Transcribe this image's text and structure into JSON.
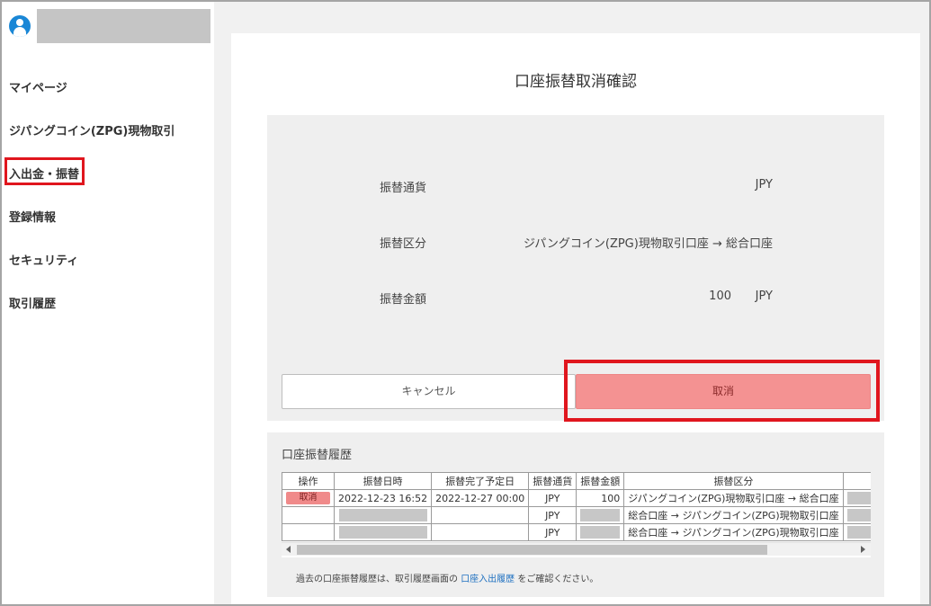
{
  "sidebar": {
    "items": [
      {
        "label": "マイページ"
      },
      {
        "label": "ジパングコイン(ZPG)現物取引"
      },
      {
        "label": "入出金・振替"
      },
      {
        "label": "登録情報"
      },
      {
        "label": "セキュリティ"
      },
      {
        "label": "取引履歴"
      }
    ]
  },
  "page": {
    "title": "口座振替取消確認"
  },
  "confirm": {
    "rows": [
      {
        "label": "振替通貨",
        "value": "JPY"
      },
      {
        "label": "振替区分",
        "value": "ジパングコイン(ZPG)現物取引口座 → 総合口座"
      },
      {
        "label": "振替金額",
        "amount": "100",
        "currency": "JPY"
      }
    ],
    "cancel_label": "キャンセル",
    "confirm_label": "取消"
  },
  "history": {
    "title": "口座振替履歴",
    "columns": [
      "操作",
      "振替日時",
      "振替完了予定日",
      "振替通貨",
      "振替金額",
      "振替区分"
    ],
    "rows": [
      {
        "action": "取消",
        "datetime": "2022-12-23 16:52",
        "due": "2022-12-27 00:00",
        "currency": "JPY",
        "amount": "100",
        "type": "ジパングコイン(ZPG)現物取引口座 → 総合口座"
      },
      {
        "action": "",
        "datetime": "",
        "due": "",
        "currency": "JPY",
        "amount": "",
        "type": "総合口座 → ジパングコイン(ZPG)現物取引口座"
      },
      {
        "action": "",
        "datetime": "",
        "due": "",
        "currency": "JPY",
        "amount": "",
        "type": "総合口座 → ジパングコイン(ZPG)現物取引口座"
      }
    ],
    "footnote_pre": "過去の口座振替履歴は、取引履歴画面の ",
    "footnote_link": "口座入出履歴",
    "footnote_post": " をご確認ください。"
  },
  "colors": {
    "accent_red": "#e0161e",
    "confirm_button": "#f49292",
    "link": "#1e70c0",
    "avatar": "#1a87d6"
  }
}
